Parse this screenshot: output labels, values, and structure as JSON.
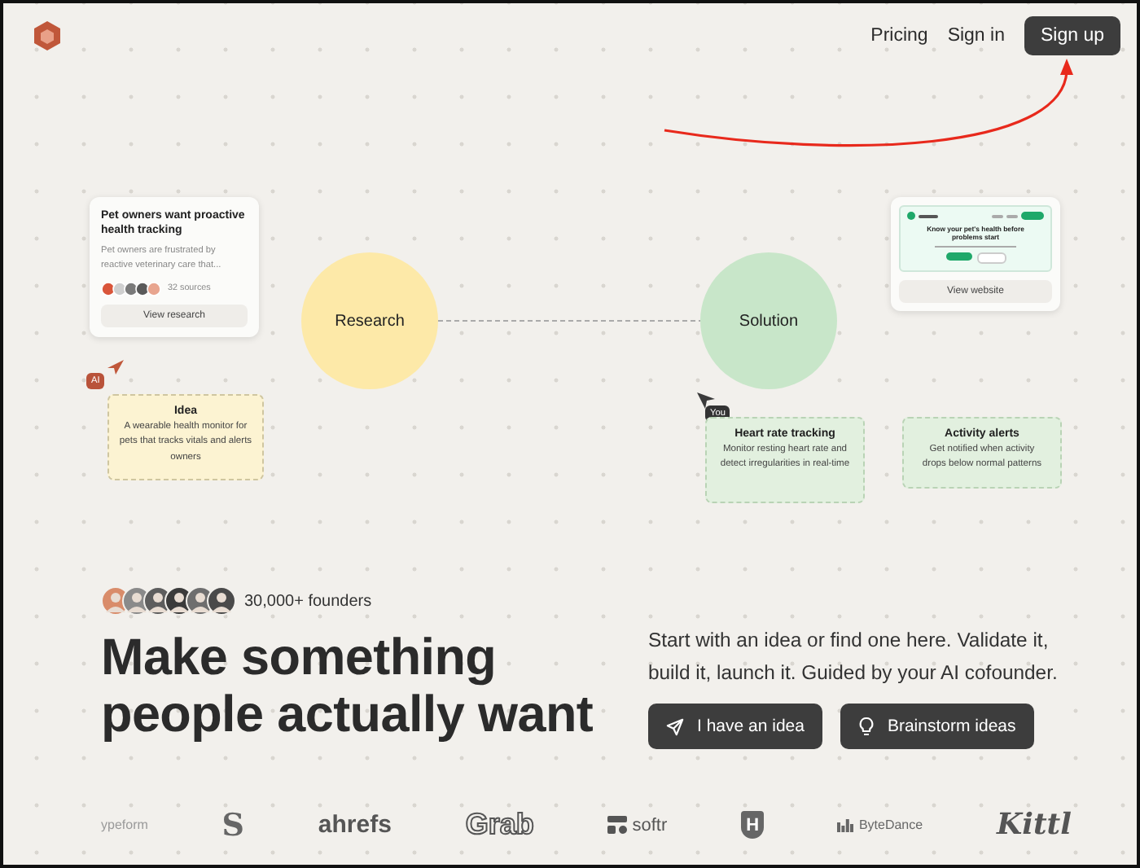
{
  "header": {
    "nav": [
      {
        "label": "Pricing",
        "kind": "link"
      },
      {
        "label": "Sign in",
        "kind": "link"
      },
      {
        "label": "Sign up",
        "kind": "button"
      }
    ]
  },
  "canvas": {
    "research_card": {
      "title": "Pet owners want proactive health tracking",
      "body": "Pet owners are frustrated by reactive veterinary care that...",
      "sources": "32 sources",
      "button": "View research"
    },
    "ai_tag": "AI",
    "idea_card": {
      "title": "Idea",
      "body": "A wearable health monitor for pets that tracks vitals and alerts owners"
    },
    "nodes": [
      {
        "label": "Research",
        "color": "#fde9a8"
      },
      {
        "label": "Solution",
        "color": "#c8e6c9"
      }
    ],
    "website_card": {
      "preview": {
        "headline": "Know your pet's health before problems start"
      },
      "button": "View website"
    },
    "you_tag": "You",
    "features": [
      {
        "title": "Heart rate tracking",
        "body": "Monitor resting heart rate and detect irregularities in real-time"
      },
      {
        "title": "Activity alerts",
        "body": "Get notified when activity drops below normal patterns"
      }
    ]
  },
  "hero": {
    "founders": "30,000+ founders",
    "headline": "Make something people actually want",
    "tagline": "Start with an idea or find one here. Validate it, build it, launch it. Guided by your AI cofounder.",
    "buttons": [
      {
        "label": "I have an idea",
        "kind": "send"
      },
      {
        "label": "Brainstorm ideas",
        "kind": "bulb"
      }
    ]
  },
  "logos": [
    {
      "kind": "faded-wordmark",
      "text": "ypeform"
    },
    {
      "kind": "tall-letter",
      "text": "S"
    },
    {
      "kind": "wordmark",
      "text": "ahrefs"
    },
    {
      "kind": "outline-wordmark",
      "text": "Grab"
    },
    {
      "kind": "blocks-wordmark",
      "text": "softr"
    },
    {
      "kind": "shield-letter",
      "text": "H"
    },
    {
      "kind": "bars-wordmark",
      "text": "ByteDance"
    },
    {
      "kind": "script-wordmark",
      "text": "Kittl"
    }
  ]
}
